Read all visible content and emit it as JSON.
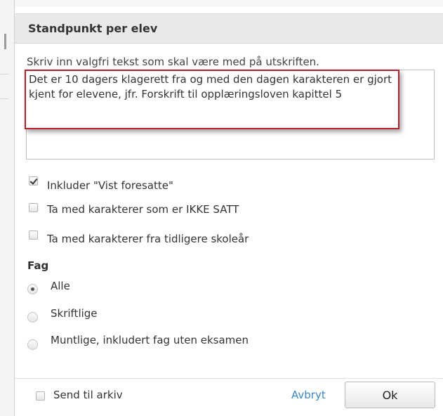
{
  "dialog": {
    "title": "Standpunkt per elev",
    "instruction": "Skriv inn valgfri tekst som skal være med på utskriften.",
    "note_text": "Det er 10 dagers klagerett fra og med den dagen karakteren er gjort kjent for elevene, jfr. Forskrift til opplæringsloven kapittel 5",
    "options": [
      {
        "label": "Inkluder \"Vist foresatte\"",
        "checked": true
      },
      {
        "label": "Ta med karakterer som er IKKE SATT",
        "checked": false
      },
      {
        "label": "Ta med karakterer fra tidligere skoleår",
        "checked": false
      }
    ],
    "fag": {
      "heading": "Fag",
      "choices": [
        {
          "label": "Alle",
          "selected": true
        },
        {
          "label": "Skriftlige",
          "selected": false
        },
        {
          "label": "Muntlige, inkludert fag uten eksamen",
          "selected": false
        }
      ]
    },
    "footer": {
      "send_archive": "Send til arkiv",
      "send_archive_checked": false,
      "cancel": "Avbryt",
      "ok": "Ok"
    }
  },
  "colors": {
    "header_bg": "#e9e9e9",
    "highlight_border": "#b3202a",
    "link": "#3a86c8"
  }
}
